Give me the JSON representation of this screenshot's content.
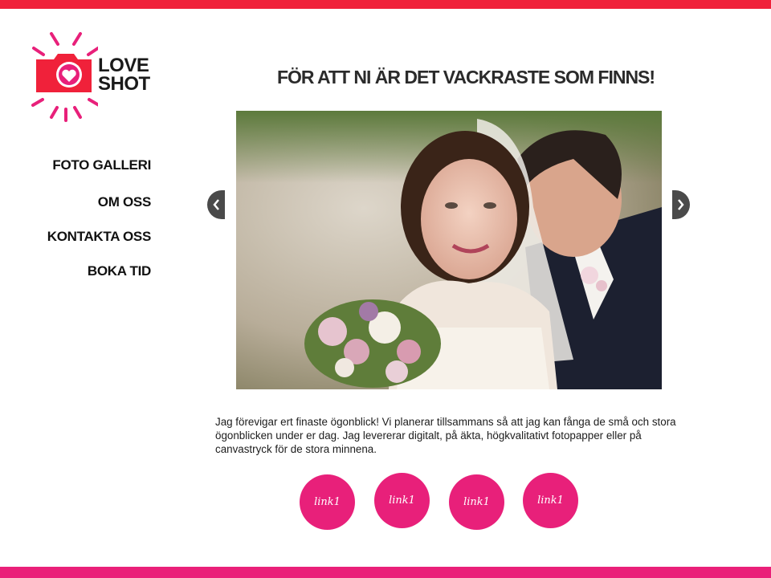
{
  "brand": {
    "logo_line1": "LOVE",
    "logo_line2": "SHOT",
    "accent_color": "#e8207a",
    "top_bar_color": "#f0213a"
  },
  "nav": {
    "items": [
      {
        "label": "FOTO GALLERI"
      },
      {
        "label": "OM OSS"
      },
      {
        "label": "KONTAKTA OSS"
      },
      {
        "label": "BOKA TID"
      }
    ]
  },
  "hero": {
    "headline": "FÖR ATT NI ÄR DET VACKRASTE SOM FINNS!",
    "prev_icon": "chevron-left-icon",
    "next_icon": "chevron-right-icon"
  },
  "intro": {
    "text": "Jag förevigar ert finaste ögonblick! Vi planerar tillsammans så att jag kan fånga de små och stora ögonblicken under er dag. Jag levererar digitalt, på äkta, högkvalitativt fotopapper eller på canvastryck för de stora minnena."
  },
  "links": [
    {
      "label": "link1"
    },
    {
      "label": "link1"
    },
    {
      "label": "link1"
    },
    {
      "label": "link1"
    }
  ]
}
